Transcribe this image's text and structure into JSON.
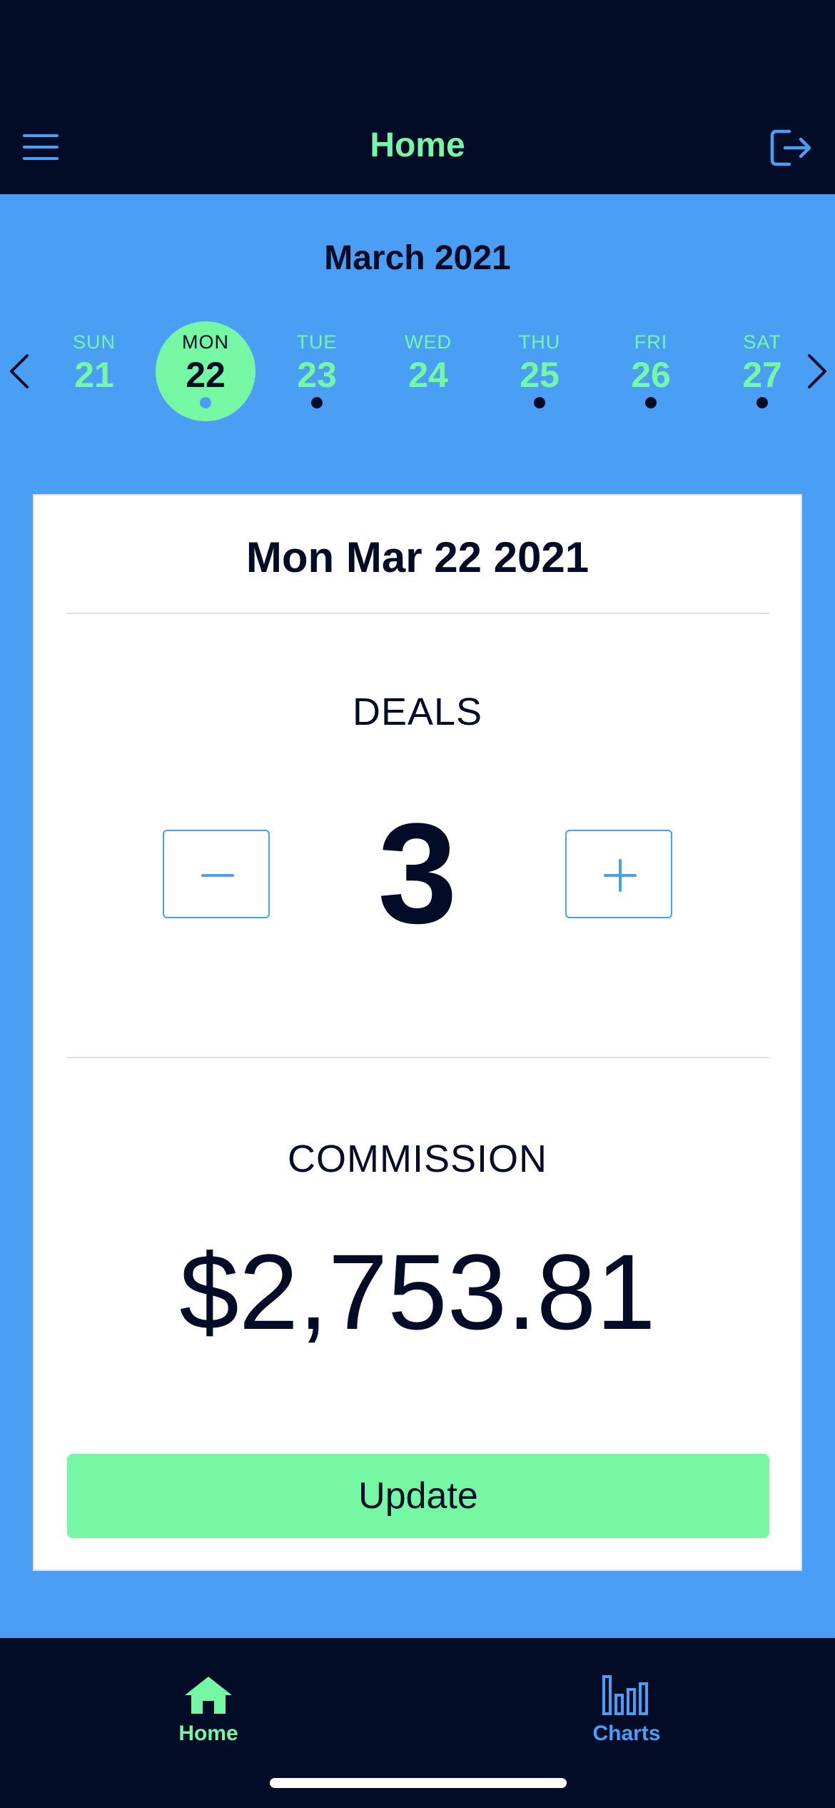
{
  "header": {
    "title": "Home",
    "menu_icon": "hamburger-menu-icon",
    "logout_icon": "logout-icon"
  },
  "calendar": {
    "month_label": "March 2021",
    "days": [
      {
        "name": "SUN",
        "number": "21",
        "selected": false,
        "has_dot": false
      },
      {
        "name": "MON",
        "number": "22",
        "selected": true,
        "has_dot": true
      },
      {
        "name": "TUE",
        "number": "23",
        "selected": false,
        "has_dot": true
      },
      {
        "name": "WED",
        "number": "24",
        "selected": false,
        "has_dot": false
      },
      {
        "name": "THU",
        "number": "25",
        "selected": false,
        "has_dot": true
      },
      {
        "name": "FRI",
        "number": "26",
        "selected": false,
        "has_dot": true
      },
      {
        "name": "SAT",
        "number": "27",
        "selected": false,
        "has_dot": true
      }
    ]
  },
  "card": {
    "date_title": "Mon Mar 22 2021",
    "deals_label": "DEALS",
    "deals_value": "3",
    "commission_label": "COMMISSION",
    "commission_value": "$2,753.81",
    "update_label": "Update"
  },
  "tabs": [
    {
      "label": "Home",
      "icon": "home-icon",
      "active": true
    },
    {
      "label": "Charts",
      "icon": "bar-chart-icon",
      "active": false
    }
  ],
  "colors": {
    "navy": "#030c27",
    "blue": "#4a9ff5",
    "green": "#76f7a3",
    "white": "#ffffff"
  }
}
